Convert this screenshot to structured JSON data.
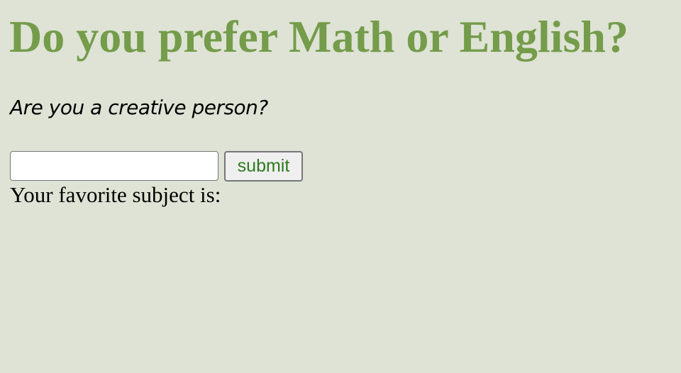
{
  "heading": "Do you prefer Math or English?",
  "question": "Are you a creative person?",
  "form": {
    "input_value": "",
    "submit_label": "submit"
  },
  "result_text": "Your favorite subject is:",
  "colors": {
    "background": "#dee3d5",
    "heading": "#749c4a",
    "button_text": "#2f7a1f"
  }
}
